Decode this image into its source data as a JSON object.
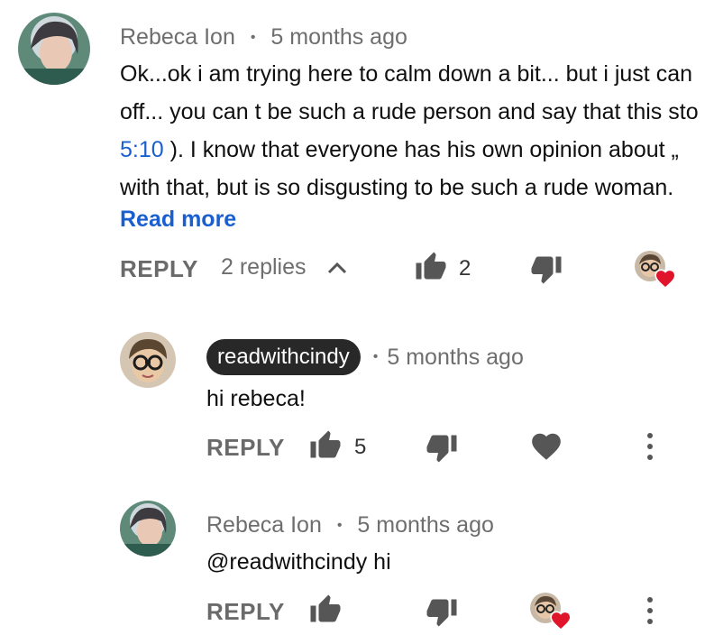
{
  "comment": {
    "author": "Rebeca Ion",
    "separator": "•",
    "time": "5 months ago",
    "lines": [
      "Ok...ok  i am trying here to calm down a bit... but i just can",
      "off... you can t be such a rude person and say that  this sto"
    ],
    "line3_link": "5:10",
    "line3_rest": " ).  I know that everyone has his own  opinion about  „",
    "line4": "with that,   but is so disgusting to be such a rude woman.",
    "read_more": "Read more",
    "reply_label": "REPLY",
    "replies_label": "2 replies",
    "likes": "2"
  },
  "replies": [
    {
      "author": "readwithcindy",
      "separator": "•",
      "time": "5 months ago",
      "text": "hi rebeca!",
      "reply_label": "REPLY",
      "likes": "5"
    },
    {
      "author": "Rebeca Ion",
      "separator": "•",
      "time": "5 months ago",
      "text": "@readwithcindy  hi",
      "reply_label": "REPLY",
      "likes": ""
    }
  ],
  "colors": {
    "heart": "#e0142a",
    "chip_bg": "#282828",
    "link": "#1a5fd0",
    "icon": "#565656"
  }
}
